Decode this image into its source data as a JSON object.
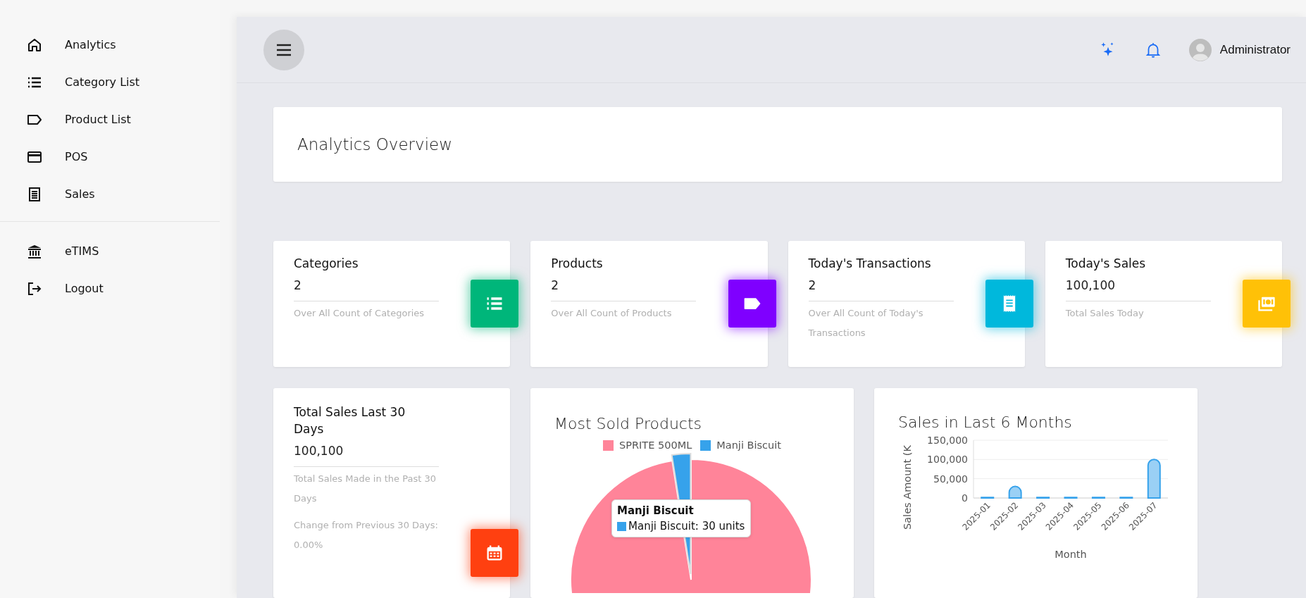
{
  "sidebar": {
    "groups": [
      {
        "items": [
          {
            "label": "Analytics",
            "kind": "home"
          },
          {
            "label": "Category List",
            "kind": "list"
          },
          {
            "label": "Product List",
            "kind": "tag"
          },
          {
            "label": "POS",
            "kind": "card"
          },
          {
            "label": "Sales",
            "kind": "receipt"
          }
        ]
      },
      {
        "items": [
          {
            "label": "eTIMS",
            "kind": "bank"
          },
          {
            "label": "Logout",
            "kind": "logout"
          }
        ]
      }
    ]
  },
  "header": {
    "user": "Administrator"
  },
  "overview": {
    "title": "Analytics Overview"
  },
  "stat_cards": [
    {
      "title": "Categories",
      "value": "2",
      "description": "Over All Count of Categories",
      "kind": "list",
      "color": "#00b67a"
    },
    {
      "title": "Products",
      "value": "2",
      "description": "Over All Count of Products",
      "kind": "tag",
      "color": "#7f00ff"
    },
    {
      "title": "Today's Transactions",
      "value": "2",
      "description": "Over All Count of Today's Transactions",
      "kind": "receipt",
      "color": "#00b8dc"
    },
    {
      "title": "Today's Sales",
      "value": "100,100",
      "description": "Total Sales Today",
      "kind": "money",
      "color": "#ffc107"
    }
  ],
  "total_sales_card": {
    "title": "Total Sales Last 30 Days",
    "value": "100,100",
    "description": "Total Sales Made in the Past 30 Days",
    "change": "Change from Previous 30 Days: 0.00%",
    "kind": "calendar",
    "color": "#ff4010"
  },
  "most_sold": {
    "title": "Most Sold Products",
    "legend": [
      {
        "label": "SPRITE 500ML",
        "color": "#ff8499"
      },
      {
        "label": "Manji Biscuit",
        "color": "#36a2eb"
      }
    ],
    "tooltip": {
      "title": "Manji Biscuit",
      "text": "Manji Biscuit: 30 units",
      "color": "#36a2eb"
    }
  },
  "sales_6_months": {
    "title": "Sales in Last 6 Months",
    "chart_data": {
      "type": "bar",
      "xlabel": "Month",
      "ylabel": "Sales Amount (K",
      "categories": [
        "2025-01",
        "2025-02",
        "2025-03",
        "2025-04",
        "2025-05",
        "2025-06",
        "2025-07"
      ],
      "values": [
        1000,
        30000,
        0,
        0,
        0,
        0,
        100000
      ],
      "yticks": [
        {
          "value": 0,
          "label": "0"
        },
        {
          "value": 50000,
          "label": "50,000"
        },
        {
          "value": 100000,
          "label": "100,000"
        },
        {
          "value": 150000,
          "label": "150,000"
        }
      ],
      "ylim": [
        0,
        150000
      ]
    }
  }
}
